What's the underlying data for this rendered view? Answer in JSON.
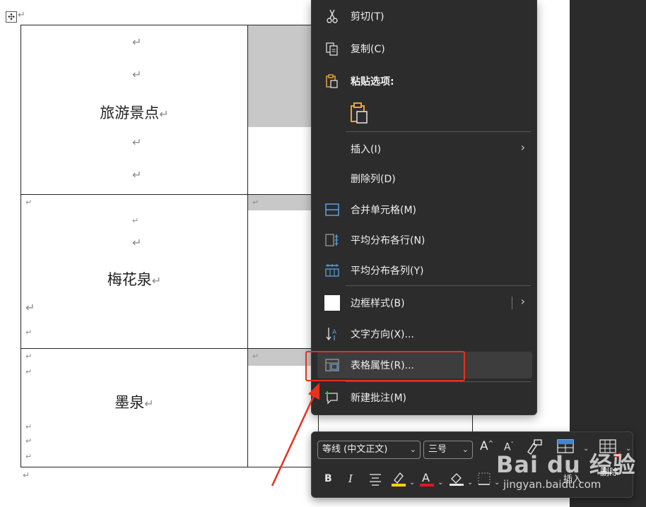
{
  "document": {
    "move_handle": "✣",
    "paragraph_mark": "↵",
    "rows": [
      {
        "label": "旅游景点"
      },
      {
        "label": "梅花泉"
      },
      {
        "label": "墨泉"
      }
    ]
  },
  "context_menu": {
    "items": [
      {
        "id": "cut",
        "label": "剪切(T)",
        "icon": "scissors-icon"
      },
      {
        "id": "copy",
        "label": "复制(C)",
        "icon": "copy-icon"
      },
      {
        "id": "paste_options",
        "label": "粘贴选项:",
        "icon": "clipboard-icon"
      },
      {
        "id": "insert",
        "label": "插入(I)",
        "has_submenu": true
      },
      {
        "id": "delete_column",
        "label": "删除列(D)"
      },
      {
        "id": "merge_cells",
        "label": "合并单元格(M)",
        "icon": "merge-cells-icon"
      },
      {
        "id": "distribute_rows",
        "label": "平均分布各行(N)",
        "icon": "distribute-rows-icon"
      },
      {
        "id": "distribute_columns",
        "label": "平均分布各列(Y)",
        "icon": "distribute-columns-icon"
      },
      {
        "id": "border_styles",
        "label": "边框样式(B)",
        "icon": "border-style-icon",
        "has_submenu": true
      },
      {
        "id": "text_direction",
        "label": "文字方向(X)...",
        "icon": "text-direction-icon"
      },
      {
        "id": "table_properties",
        "label": "表格属性(R)...",
        "icon": "table-properties-icon",
        "highlighted": true
      },
      {
        "id": "new_comment",
        "label": "新建批注(M)",
        "icon": "comment-icon"
      }
    ]
  },
  "mini_toolbar": {
    "font_name": "等线 (中文正文)",
    "font_size": "三号",
    "grow_font": "A",
    "shrink_font": "A",
    "bold": "B",
    "italic": "I",
    "insert_label": "插入",
    "delete_label": "删除"
  },
  "watermark": {
    "logo": "Bai du 经验",
    "site": "jingyan.baidu.com"
  },
  "colors": {
    "menu_bg": "#2c2c2c",
    "highlight_box": "#e8301e",
    "font_color_underline": "#e81123",
    "highlight_color": "#ffd400"
  }
}
